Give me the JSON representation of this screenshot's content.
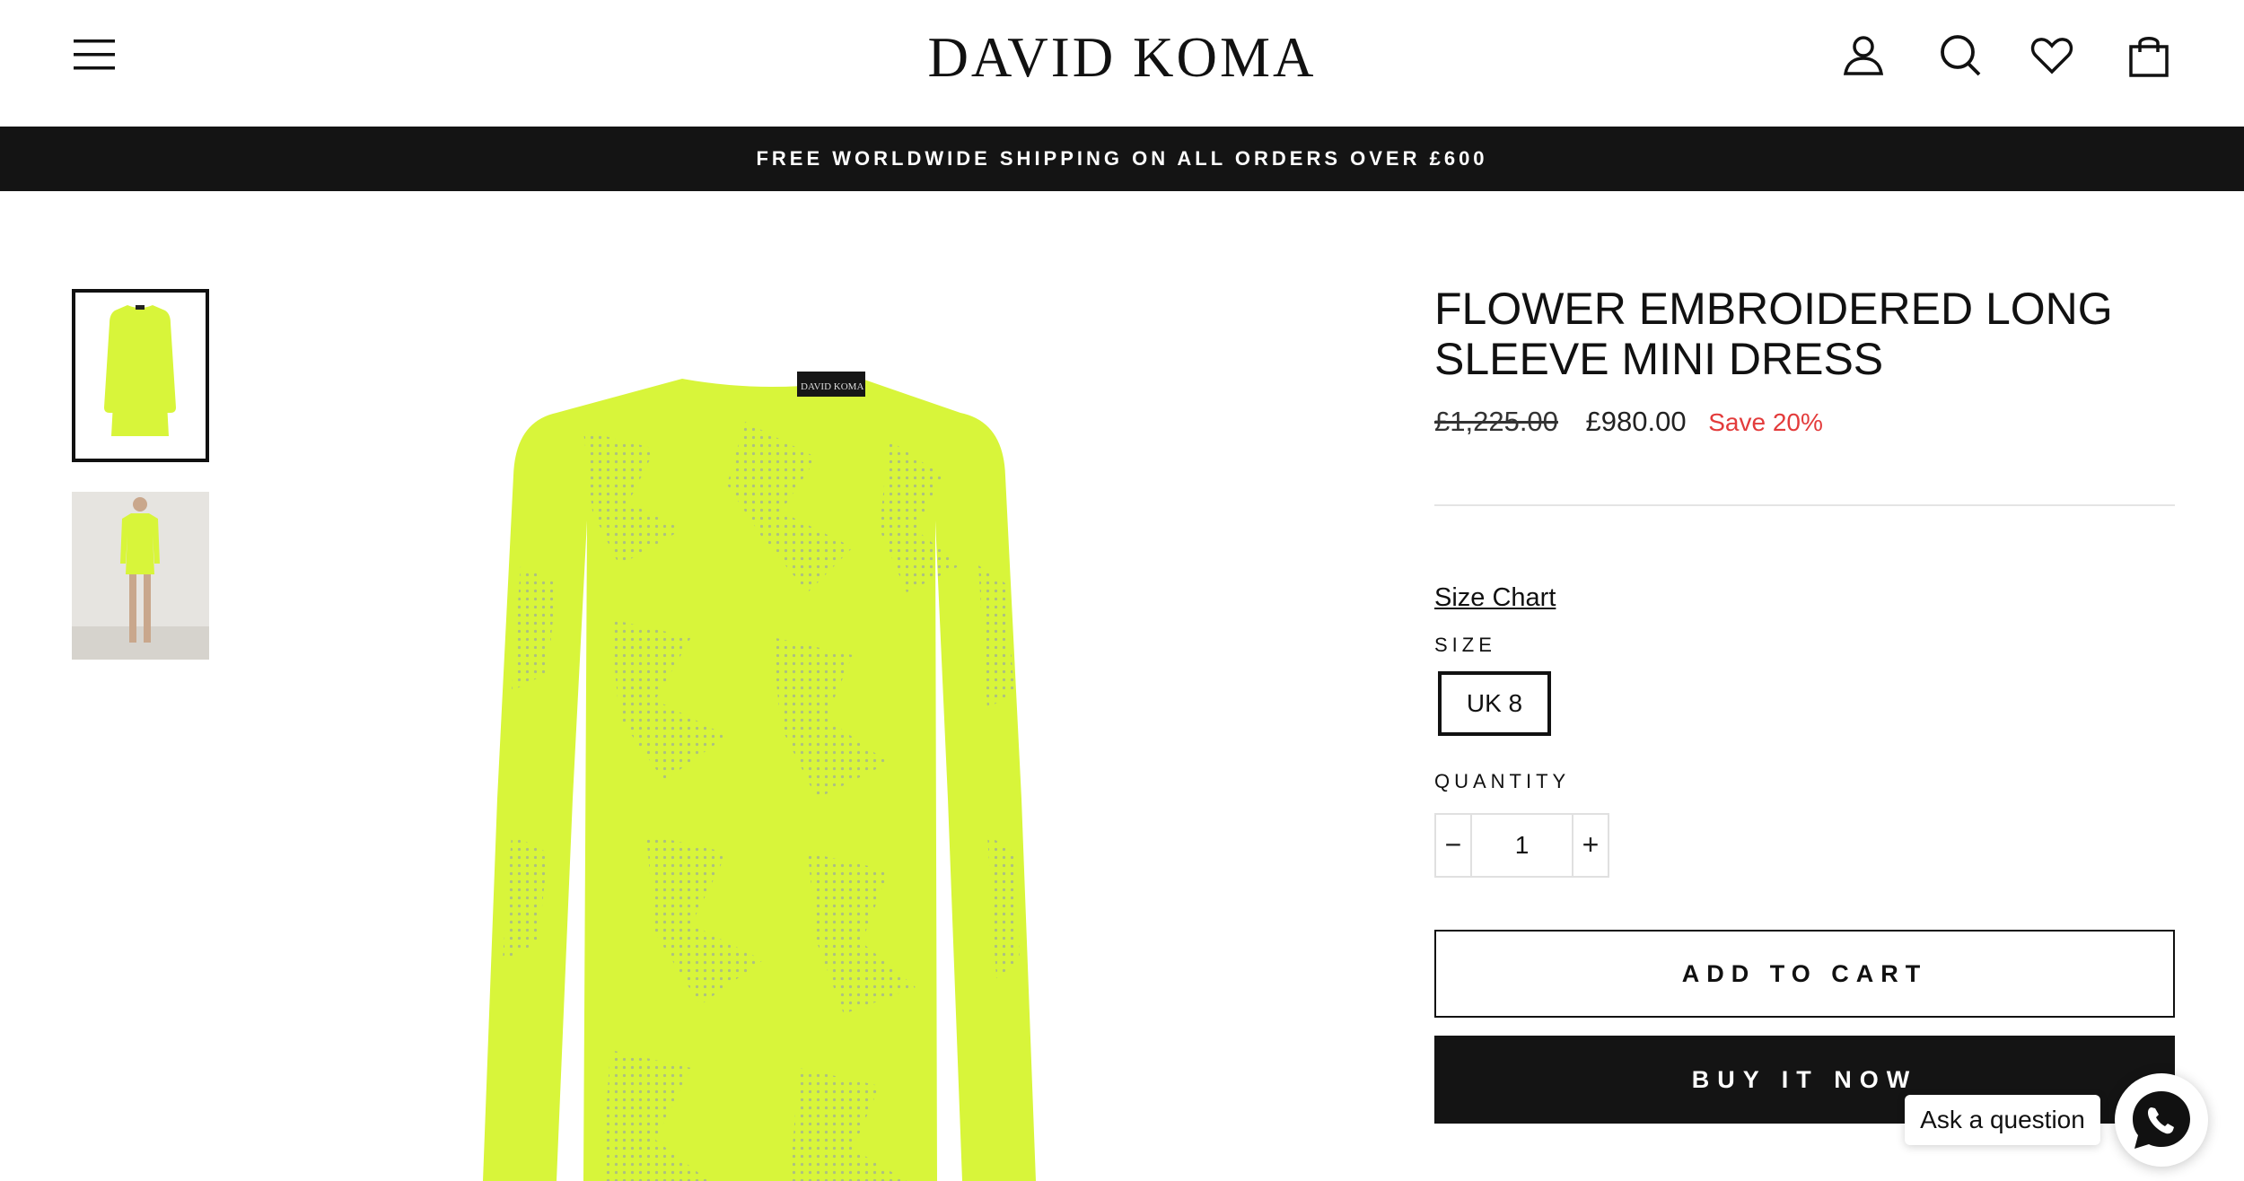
{
  "header": {
    "logo": "DAVID KOMA",
    "icons": [
      "menu-icon",
      "account-icon",
      "search-icon",
      "wishlist-icon",
      "cart-icon"
    ]
  },
  "announcement": {
    "text": "FREE WORLDWIDE SHIPPING ON ALL ORDERS OVER £600"
  },
  "gallery": {
    "main_image_label": "DAVID KOMA",
    "thumbnails": [
      "front",
      "model"
    ]
  },
  "product": {
    "title": "FLOWER EMBROIDERED LONG SLEEVE MINI DRESS",
    "price_original": "£1,225.00",
    "price_sale": "£980.00",
    "save_label": "Save 20%",
    "size_chart_label": "Size Chart",
    "size_label": "SIZE",
    "sizes": [
      "UK 8"
    ],
    "quantity_label": "QUANTITY",
    "quantity_value": "1",
    "decrement_symbol": "−",
    "increment_symbol": "+",
    "add_to_cart_label": "ADD TO CART",
    "buy_now_label": "BUY IT NOW"
  },
  "chat": {
    "ask_label": "Ask a question",
    "icon": "whatsapp-icon"
  },
  "colors": {
    "dress": "#d8f53a",
    "banner_bg": "#141414",
    "sale_red": "#e33b3b",
    "text": "#111111"
  }
}
